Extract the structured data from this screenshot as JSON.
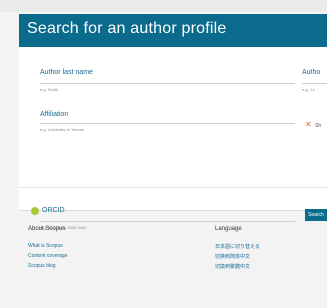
{
  "header": {
    "title": "Search for an author profile"
  },
  "form": {
    "last_name_label": "Author last name",
    "last_name_placeholder": "e.g. Smith",
    "first_name_label": "Autho",
    "first_name_placeholder": "e.g. J.L.",
    "affiliation_label": "Affiliation",
    "affiliation_placeholder": "e.g. University of Toronto",
    "option_text": "Sh",
    "orcid_label": "ORCID",
    "orcid_placeholder": "e.g. 1111-2222-3333-444x",
    "search_button": "Search"
  },
  "footer": {
    "about_heading": "About Scopus",
    "about_links": [
      "What is Scopus",
      "Content coverage",
      "Scopus blog"
    ],
    "language_heading": "Language",
    "language_links": [
      "日本語に切り替える",
      "切换到简体中文",
      "切換到繁體中文"
    ]
  },
  "colors": {
    "accent": "#0b6b8c",
    "link": "#1a6b96",
    "orcid": "#a6c93a"
  }
}
